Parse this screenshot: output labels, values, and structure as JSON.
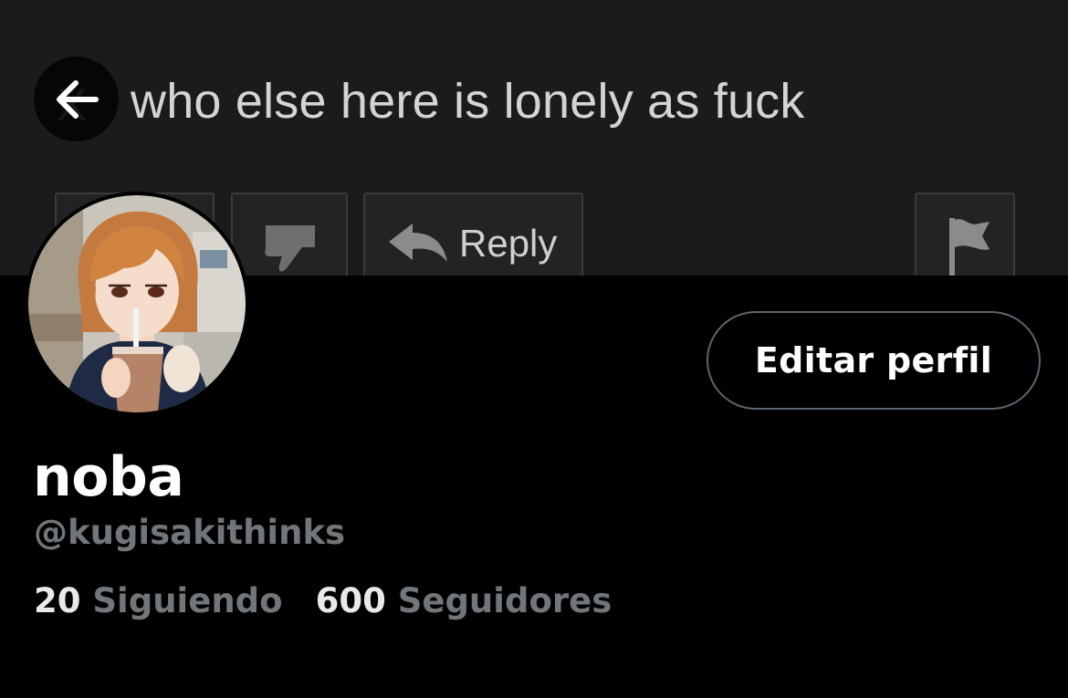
{
  "banner": {
    "comment_text": "who else here is lonely as fuck",
    "reply_label": "Reply",
    "icons": [
      "upvote-icon",
      "downvote-icon",
      "reply-arrow-icon",
      "flag-icon"
    ],
    "background_color": "#1b1b1c"
  },
  "header": {
    "back_icon": "arrow-left-icon"
  },
  "profile": {
    "display_name": "noba",
    "handle": "@kugisakithinks",
    "edit_profile_label": "Editar perfil",
    "following_count": "20",
    "following_label": "Siguiendo",
    "followers_count": "600",
    "followers_label": "Seguidores"
  },
  "colors": {
    "background": "#000000",
    "primary_text": "#e7e9ea",
    "secondary_text": "#71767b",
    "button_border": "#5b6670"
  }
}
